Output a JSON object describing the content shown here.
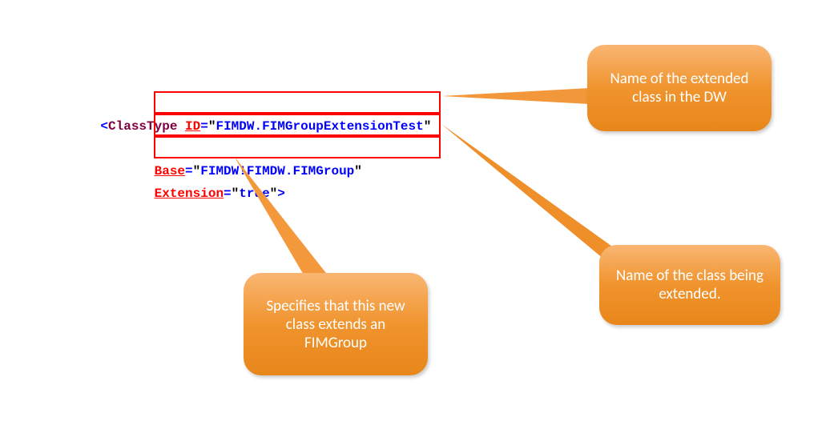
{
  "code": {
    "tag_open": "<",
    "tag_name": "ClassType",
    "attr1_name": "ID",
    "attr1_value": "FIMDW.FIMGroupExtensionTest",
    "attr2_name": "Base",
    "attr2_value": "FIMDW!FIMDW.FIMGroup",
    "attr3_name": "Extension",
    "attr3_value": "true",
    "tag_close": ">"
  },
  "callouts": {
    "top_right": "Name of the extended class in the DW",
    "bottom_right": "Name of the class being extended.",
    "bottom_center": "Specifies that this new class extends an FIMGroup"
  }
}
